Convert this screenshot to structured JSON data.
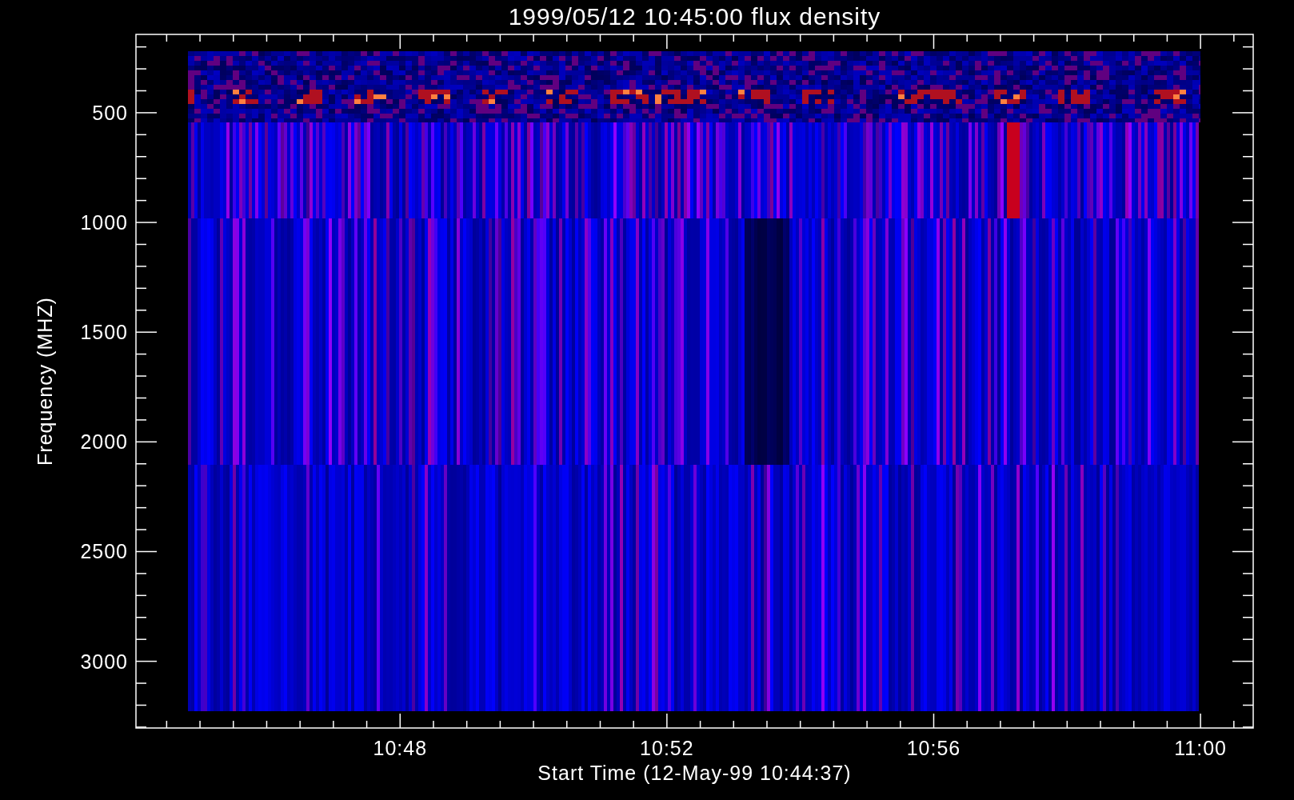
{
  "plot": {
    "title": "1999/05/12 10:45:00 flux density",
    "xlabel": "Start Time (12-May-99 10:44:37)",
    "ylabel": "Frequency (MHZ)",
    "xticks": [
      "10:48",
      "10:52",
      "10:56",
      "11:00"
    ],
    "yticks": [
      "500",
      "1000",
      "1500",
      "2000",
      "2500",
      "3000"
    ]
  }
}
